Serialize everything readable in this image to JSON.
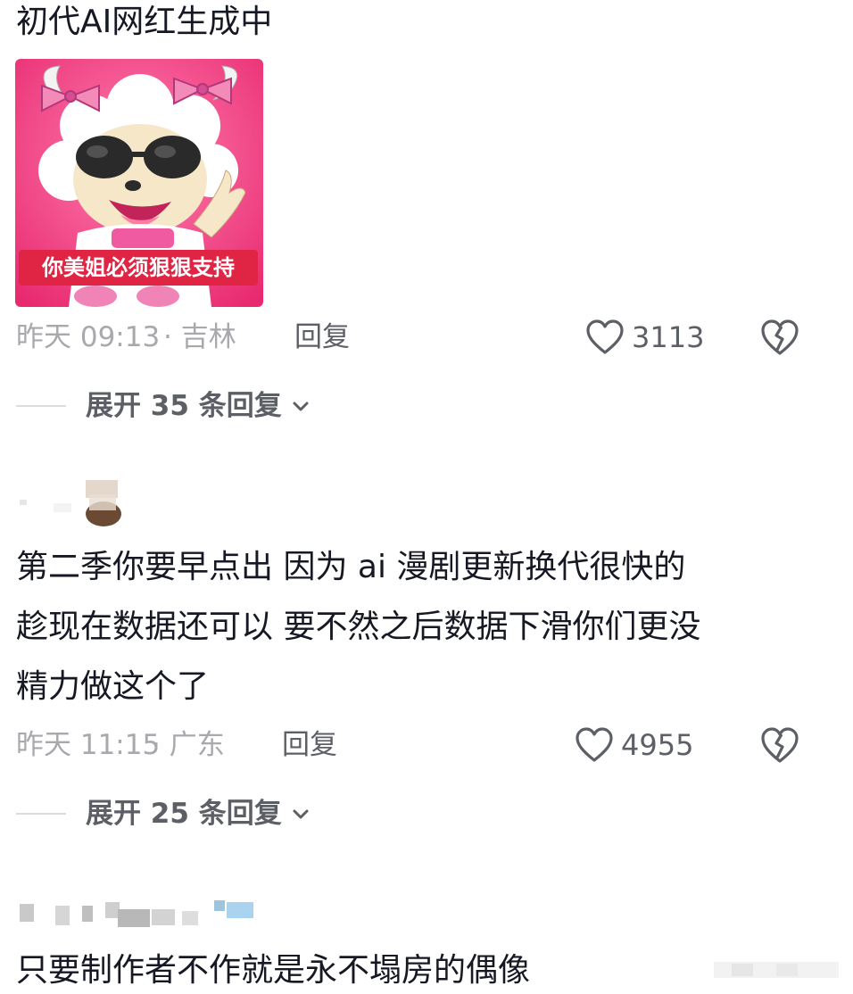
{
  "comments": [
    {
      "text": "初代AI网红生成中",
      "sticker": {
        "caption": "你美姐必须狠狠支持",
        "icon": "sheep-cartoon-sticker"
      },
      "time": "昨天 09:13",
      "location": "· 吉林",
      "reply_label": "回复",
      "likes": "3113",
      "expand_label": "展开 35 条回复"
    },
    {
      "text_lines": [
        "第二季你要早点出 因为 ai 漫剧更新换代很快的",
        "趁现在数据还可以 要不然之后数据下滑你们更没",
        "精力做这个了"
      ],
      "time": "昨天 11:15",
      "location": "· 广东",
      "reply_label": "回复",
      "likes": "4955",
      "expand_label": "展开 25 条回复"
    },
    {
      "text": "只要制作者不作就是永不塌房的偶像"
    }
  ],
  "icons": {
    "like": "heart-outline-icon",
    "dislike": "broken-heart-icon",
    "expand": "chevron-down-icon"
  },
  "colors": {
    "text_primary": "#161823",
    "text_meta": "#a8a8ad",
    "text_action": "#5d5f66",
    "sticker_bg": "#f0407f",
    "caption_bg": "#e02443"
  }
}
